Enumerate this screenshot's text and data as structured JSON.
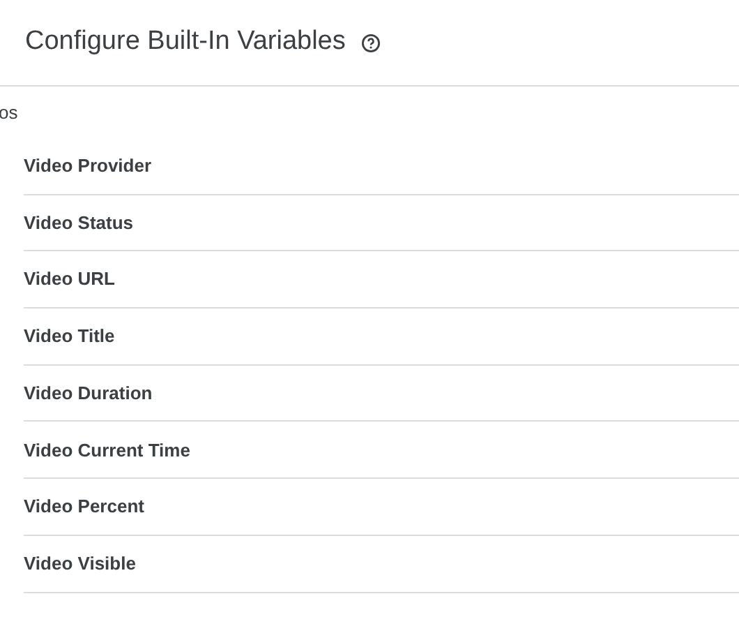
{
  "panel": {
    "title": "Configure Built-In Variables"
  },
  "section": {
    "label": "os"
  },
  "variables": [
    {
      "label": "Video Provider"
    },
    {
      "label": "Video Status"
    },
    {
      "label": "Video URL"
    },
    {
      "label": "Video Title"
    },
    {
      "label": "Video Duration"
    },
    {
      "label": "Video Current Time"
    },
    {
      "label": "Video Percent"
    },
    {
      "label": "Video Visible"
    }
  ]
}
